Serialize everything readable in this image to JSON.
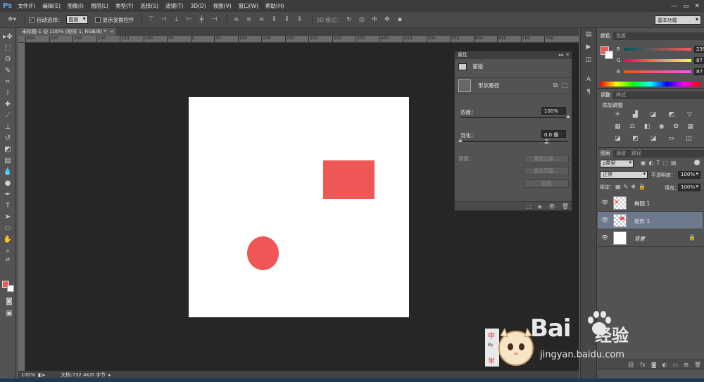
{
  "app": {
    "logo": "Ps"
  },
  "menu": [
    "文件(F)",
    "编辑(E)",
    "图像(I)",
    "图层(L)",
    "类型(Y)",
    "选择(S)",
    "滤镜(T)",
    "3D(D)",
    "视图(V)",
    "窗口(W)",
    "帮助(H)"
  ],
  "window_controls": {
    "minimize": "—",
    "maximize": "▭",
    "close": "✕"
  },
  "options": {
    "auto_select_label": "自动选择：",
    "auto_select_value": "图层",
    "show_transform_label": "显示变换控件",
    "mode_3d_label": "3D 模式：",
    "workspace": "基本功能"
  },
  "document": {
    "tab_title": "未标题-1 @ 100% (矩形 1, RGB/8) *",
    "close": "×"
  },
  "ruler_labels": [
    "350",
    "300",
    "250",
    "200",
    "150",
    "100",
    "50",
    "0",
    "50",
    "100",
    "150",
    "200",
    "250",
    "300",
    "350",
    "400",
    "450",
    "500",
    "550",
    "600",
    "650",
    "700",
    "750"
  ],
  "status": {
    "zoom": "100%",
    "doc_info": "文档:732.4K/0 字节"
  },
  "properties": {
    "panel_title": "属性",
    "mask_label": "蒙版",
    "vector_label": "形状路径",
    "density_label": "浓度：",
    "density_value": "100%",
    "density": 1.0,
    "feather_label": "羽化：",
    "feather_value": "0.0 像素",
    "feather": 0.0,
    "adjust_label": "调整：",
    "btn_mask_edge": "蒙版边缘…",
    "btn_color_range": "颜色范围…",
    "btn_invert": "反相"
  },
  "color_panel": {
    "tabs": [
      "颜色",
      "色板"
    ],
    "r_label": "R",
    "g_label": "G",
    "b_label": "B",
    "r": "239",
    "g": "87",
    "b": "87",
    "fg_color": "#ef5757"
  },
  "adjust_panel": {
    "tabs": [
      "调整",
      "样式"
    ],
    "title": "添加调整"
  },
  "layers_panel": {
    "tabs": [
      "图层",
      "通道",
      "路径"
    ],
    "filter": "ρ类型",
    "blend_mode": "正常",
    "opacity_label": "不透明度：",
    "opacity_value": "100%",
    "lock_label": "锁定：",
    "fill_label": "填充：",
    "fill_value": "100%",
    "layers": [
      {
        "name": "椭圆 1",
        "selected": false
      },
      {
        "name": "矩形 1",
        "selected": true
      },
      {
        "name": "背景",
        "selected": false
      }
    ]
  },
  "watermark": {
    "logo": "Bai",
    "logo_suffix": "经验",
    "url": "jingyan.baidu.com",
    "badge_top": "中",
    "badge_bottom": "半",
    "badge_by": "By"
  },
  "colors": {
    "accent": "#ef5757",
    "panel": "#535353",
    "canvas": "#262626"
  }
}
